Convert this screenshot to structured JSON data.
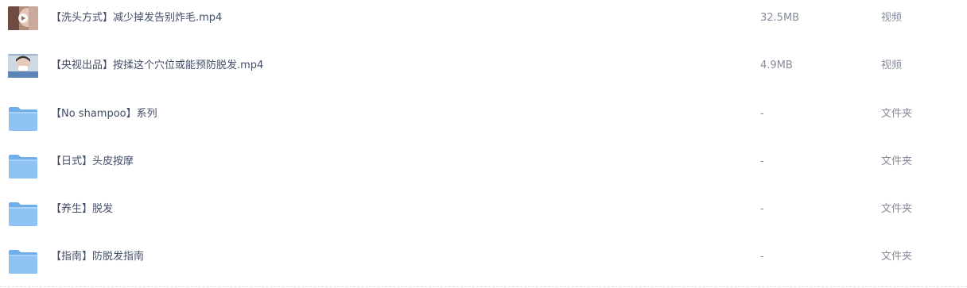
{
  "files": [
    {
      "kind": "video",
      "icon": "video-thumbnail-icon",
      "name": "【洗头方式】减少掉发告别炸毛.mp4",
      "size": "32.5MB",
      "type": "视频"
    },
    {
      "kind": "video",
      "icon": "video-thumbnail-icon",
      "name": "【央视出品】按揉这个穴位或能预防脱发.mp4",
      "size": "4.9MB",
      "type": "视频"
    },
    {
      "kind": "folder",
      "icon": "folder-icon",
      "name": "【No shampoo】系列",
      "size": "-",
      "type": "文件夹"
    },
    {
      "kind": "folder",
      "icon": "folder-icon",
      "name": "【日式】头皮按摩",
      "size": "-",
      "type": "文件夹"
    },
    {
      "kind": "folder",
      "icon": "folder-icon",
      "name": "【养生】脱发",
      "size": "-",
      "type": "文件夹"
    },
    {
      "kind": "folder",
      "icon": "folder-icon",
      "name": "【指南】防脱发指南",
      "size": "-",
      "type": "文件夹"
    }
  ],
  "colors": {
    "name_text": "#424e67",
    "meta_text": "#878c9c",
    "folder_fill": "#8ec3f4",
    "folder_tab": "#6faee9"
  }
}
